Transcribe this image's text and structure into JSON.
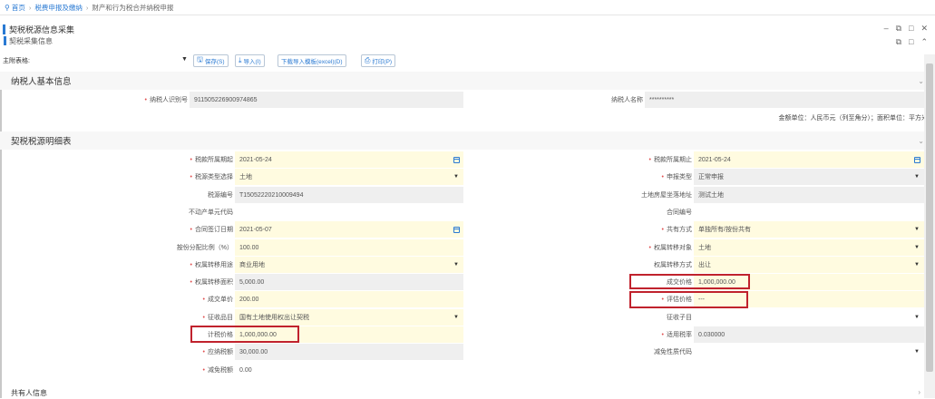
{
  "breadcrumb": {
    "home": "首页",
    "level1": "税费申报及缴纳",
    "level2": "财产和行为税合并纳税申报"
  },
  "window": {
    "title": "契税税源信息采集",
    "subtitle": "契税采集信息",
    "controls": [
      "–",
      "⧉",
      "□",
      "✕"
    ]
  },
  "toolbar": {
    "field_label": "主附表格:",
    "save": "保存(S)",
    "import": "导入(I)",
    "download": "下载导入模板(excel)(D)",
    "print": "打印(P)"
  },
  "basic": {
    "title": "纳税人基本信息",
    "taxpayer_id_label": "纳税人识别号",
    "taxpayer_id": "911505226900974865",
    "taxpayer_name_label": "纳税人名称",
    "taxpayer_name": "**********",
    "unit_note": "金额单位：人民币元（列至角分）；面积单位：平方米"
  },
  "detail": {
    "title": "契税税源明细表",
    "rows": [
      {
        "l_label": "税款所属期起",
        "l_req": true,
        "l_val": "2021-05-24",
        "l_bg": "yellow",
        "l_ctrl": "cal",
        "r_label": "税款所属期止",
        "r_req": true,
        "r_val": "2021-05-24",
        "r_bg": "yellow",
        "r_ctrl": "cal"
      },
      {
        "l_label": "税源类型选择",
        "l_req": true,
        "l_val": "土地",
        "l_bg": "yellow",
        "l_ctrl": "dd",
        "r_label": "申报类型",
        "r_req": true,
        "r_val": "正常申报",
        "r_bg": "gray",
        "r_ctrl": "dd"
      },
      {
        "l_label": "税源编号",
        "l_req": false,
        "l_val": "T15052220210009494",
        "l_bg": "gray",
        "l_ctrl": "",
        "r_label": "土地房屋坐落地址",
        "r_req": false,
        "r_val": "测试土地",
        "r_bg": "gray",
        "r_ctrl": ""
      },
      {
        "l_label": "不动产单元代码",
        "l_req": false,
        "l_val": "",
        "l_bg": "white",
        "l_ctrl": "",
        "r_label": "合同编号",
        "r_req": false,
        "r_val": "",
        "r_bg": "white",
        "r_ctrl": ""
      },
      {
        "l_label": "合同签订日期",
        "l_req": true,
        "l_val": "2021-05-07",
        "l_bg": "yellow",
        "l_ctrl": "cal",
        "r_label": "共有方式",
        "r_req": true,
        "r_val": "单独所有/按份共有",
        "r_bg": "yellow",
        "r_ctrl": "dd"
      },
      {
        "l_label": "按份分配比例（%）",
        "l_req": false,
        "l_val": "100.00",
        "l_bg": "yellow",
        "l_ctrl": "",
        "r_label": "权属转移对象",
        "r_req": true,
        "r_val": "土地",
        "r_bg": "yellow",
        "r_ctrl": "dd"
      },
      {
        "l_label": "权属转移用途",
        "l_req": true,
        "l_val": "商业用地",
        "l_bg": "yellow",
        "l_ctrl": "dd",
        "r_label": "权属转移方式",
        "r_req": false,
        "r_val": "出让",
        "r_bg": "yellow",
        "r_ctrl": "dd"
      },
      {
        "l_label": "权属转移面积",
        "l_req": true,
        "l_val": "5,000.00",
        "l_bg": "gray",
        "l_ctrl": "",
        "r_label": "成交价格",
        "r_req": false,
        "r_val": "1,000,000.00",
        "r_bg": "yellow",
        "r_ctrl": ""
      },
      {
        "l_label": "成交单价",
        "l_req": true,
        "l_val": "200.00",
        "l_bg": "yellow",
        "l_ctrl": "",
        "r_label": "评估价格",
        "r_req": true,
        "r_val": "---",
        "r_bg": "yellow",
        "r_ctrl": ""
      },
      {
        "l_label": "征收品目",
        "l_req": true,
        "l_val": "国有土地使用权出让契税",
        "l_bg": "yellow",
        "l_ctrl": "dd",
        "r_label": "征收子目",
        "r_req": false,
        "r_val": "",
        "r_bg": "white",
        "r_ctrl": "dd"
      },
      {
        "l_label": "计税价格",
        "l_req": false,
        "l_val": "1,000,000.00",
        "l_bg": "yellow",
        "l_ctrl": "",
        "r_label": "适用税率",
        "r_req": true,
        "r_val": "0.030000",
        "r_bg": "gray",
        "r_ctrl": ""
      },
      {
        "l_label": "应纳税额",
        "l_req": true,
        "l_val": "30,000.00",
        "l_bg": "gray",
        "l_ctrl": "",
        "r_label": "减免性质代码",
        "r_req": false,
        "r_val": "",
        "r_bg": "white",
        "r_ctrl": "dd"
      },
      {
        "l_label": "减免税额",
        "l_req": true,
        "l_val": "0.00",
        "l_bg": "white",
        "l_ctrl": "",
        "r_label": "",
        "r_req": false,
        "r_val": "",
        "r_bg": "none",
        "r_ctrl": ""
      }
    ]
  },
  "footer_section": {
    "title": "共有人信息"
  },
  "icons": {
    "home": "location-pin-icon"
  },
  "colors": {
    "accent": "#2a7ad3",
    "highlight": "#c0222d",
    "required": "#e05050",
    "field_yellow": "#fffbe0",
    "field_gray": "#efefef"
  }
}
